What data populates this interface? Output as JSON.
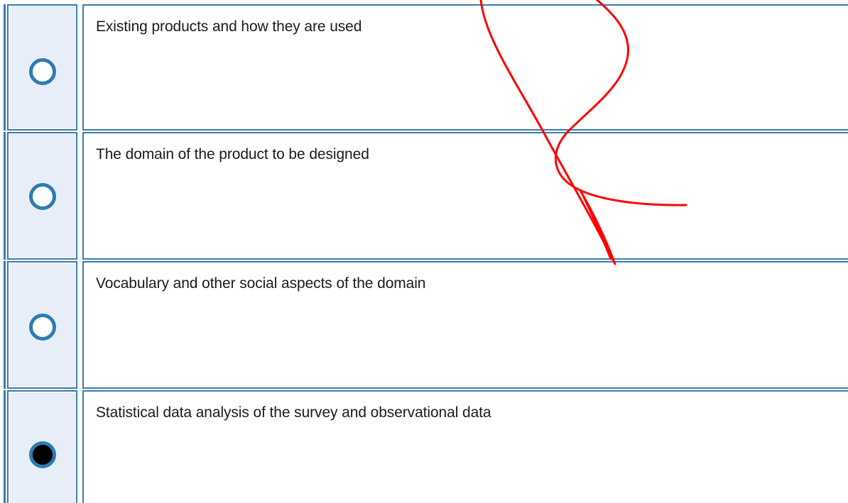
{
  "question": {
    "options": [
      {
        "label": "Existing products and how they are used",
        "selected": false
      },
      {
        "label": "The domain of the product to be designed",
        "selected": false
      },
      {
        "label": "Vocabulary and other social aspects of the domain",
        "selected": false
      },
      {
        "label": "Statistical data analysis of the survey and observational data",
        "selected": true
      }
    ]
  },
  "colors": {
    "cell_border": "#3a7ab0",
    "radio_cell_bg": "#e8eef8",
    "radio_ring": "#2f7bb0",
    "annotation_stroke": "#ff0000"
  },
  "annotation": {
    "type": "freehand-pen-scribble",
    "color": "#ff0000"
  }
}
